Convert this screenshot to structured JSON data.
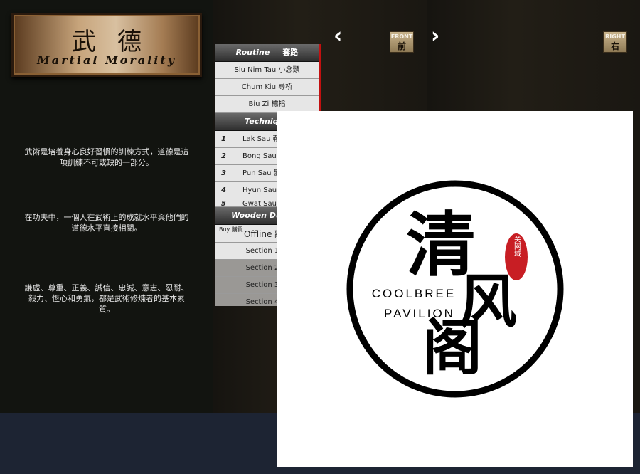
{
  "plaque": {
    "title_cn": "武德",
    "title_en": "Martial Morality"
  },
  "paragraphs": [
    "武術是培養身心良好習慣的訓練方式，道德是這項訓練不可或缺的一部分。",
    "在功夫中，一個人在武術上的成就水平與他們的道德水平直接相關。",
    "謙虛、尊重、正義、誠信、忠誠、意志、忍耐、毅力、恆心和勇氣，都是武術修煉者的基本素質。"
  ],
  "views": {
    "left": {
      "en": "FRONT",
      "cn": "前"
    },
    "right": {
      "en": "RIGHT",
      "cn": "右"
    }
  },
  "routine": {
    "header_en": "Routine",
    "header_cn": "套路",
    "items": [
      "Siu Nim Tau 小念頭",
      "Chum Kiu 尋桥",
      "Biu Zi 標指"
    ]
  },
  "technique": {
    "header_en": "Technique",
    "items": [
      {
        "num": "1",
        "label": "Lak Sau 勒"
      },
      {
        "num": "2",
        "label": "Bong Sau 膀"
      },
      {
        "num": "3",
        "label": "Pun Sau 盤"
      },
      {
        "num": "4",
        "label": "Hyun Sau 圈"
      },
      {
        "num": "5",
        "label": "Gwat Sau 刮"
      }
    ]
  },
  "wooden_dummy": {
    "header_en": "Wooden Dummy",
    "buy_label": "Buy 購買",
    "offline_label": "Offline 離",
    "sections": [
      "Section 1 第",
      "Section 2 第",
      "Section 3 第",
      "Section 4 第"
    ]
  },
  "watermark": {
    "big_chars": [
      "清",
      "风",
      "阁"
    ],
    "seal_text": "关网域",
    "line1": "COOLBREE",
    "line2": "PAVILION"
  },
  "colors": {
    "accent_red": "#c21010",
    "seal_red": "#c81e24",
    "plaque_gold": "#c7a47b"
  }
}
